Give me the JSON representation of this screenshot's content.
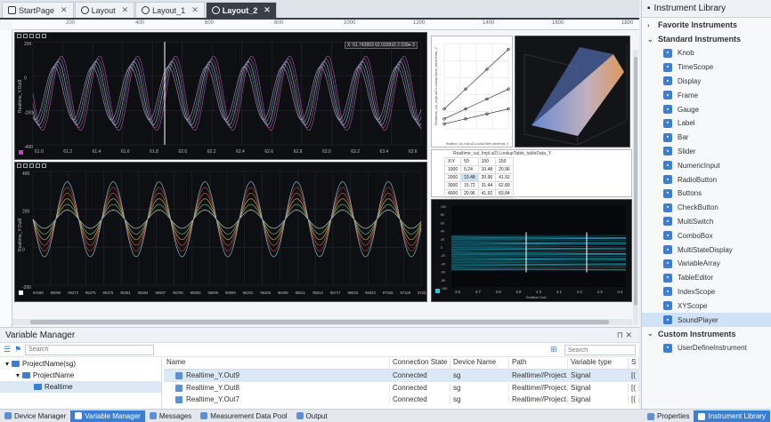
{
  "tabs": [
    {
      "label": "StartPage",
      "active": false
    },
    {
      "label": "Layout",
      "active": false
    },
    {
      "label": "Layout_1",
      "active": false
    },
    {
      "label": "Layout_2",
      "active": true
    }
  ],
  "ruler": {
    "top": [
      "200",
      "400",
      "600",
      "800",
      "1000",
      "1200",
      "1400",
      "1600",
      "1800"
    ]
  },
  "scope1": {
    "readout": "X: 61.742893   62.032893   2.039e-3",
    "y_title": "Realtime_Y.Out9",
    "y_ticks": [
      "200",
      "0",
      "-200",
      "-400"
    ],
    "x_ticks": [
      "61.0",
      "61.2",
      "61.4",
      "61.6",
      "61.8",
      "62.0",
      "62.2",
      "62.4",
      "62.6",
      "62.8",
      "63.0",
      "63.2",
      "63.4",
      "63.6"
    ]
  },
  "scope2": {
    "y_title": "Realtime_Y.Out8",
    "y_ticks": [
      "400",
      "200",
      "0",
      "-200"
    ],
    "x_ticks": [
      "94466",
      "95069",
      "95372",
      "95275",
      "95378",
      "95481",
      "95584",
      "95687",
      "95790",
      "95893",
      "96096",
      "96099",
      "96202",
      "96305",
      "96408",
      "96511",
      "96614",
      "96717",
      "96820",
      "96923",
      "97026",
      "97129",
      "97232"
    ]
  },
  "xy_chart": {
    "y_title": "Realtime_cal_Impl.uiD.LookupTable_tableData_Y",
    "x_title": "Realtime_cal_Impl.uiD.LookupTable_tableData_X"
  },
  "table_editor": {
    "title": "Realtime_cal_Impl.uiD.LookupTable_tableData_Y",
    "header": [
      "X\\Y",
      "50",
      "100",
      "150"
    ],
    "rows": [
      [
        "1000",
        "5.24",
        "10.48",
        "20.96"
      ],
      [
        "2000",
        "10.48",
        "20.96",
        "41.92"
      ],
      [
        "3000",
        "15.72",
        "31.44",
        "62.89"
      ],
      [
        "4000",
        "20.96",
        "41.92",
        "83.84"
      ]
    ]
  },
  "heatmap": {
    "y_ticks": [
      "100",
      "80",
      "60",
      "40",
      "20",
      "0",
      "-20",
      "-40",
      "-60",
      "-80",
      "-100"
    ],
    "x_ticks": [
      "3.6",
      "3.7",
      "3.8",
      "3.9",
      "4.0",
      "4.1",
      "4.2",
      "4.3",
      "4.4"
    ],
    "x_title": "Realtime.Out1"
  },
  "library": {
    "title": "Instrument Library",
    "favorite": "Favorite Instruments",
    "standard": "Standard Instruments",
    "custom": "Custom Instruments",
    "items": [
      "Knob",
      "TimeScope",
      "Display",
      "Frame",
      "Gauge",
      "Label",
      "Bar",
      "Slider",
      "NumericInput",
      "RadioButton",
      "Buttons",
      "CheckButton",
      "MultiSwitch",
      "ComboBox",
      "MultiStateDisplay",
      "VariableArray",
      "TableEditor",
      "IndexScope",
      "XYScope",
      "SoundPlayer"
    ],
    "custom_items": [
      "UserDefineInstrument"
    ]
  },
  "varman": {
    "title": "Variable Manager",
    "search_placeholder": "Search",
    "tree": [
      "ProjectName(sg)",
      "ProjectName",
      "Realtime"
    ],
    "columns": [
      "Name",
      "Connection State",
      "Device Name",
      "Path",
      "Variable type",
      "S"
    ],
    "rows": [
      {
        "name": "Realtime_Y.Out9",
        "state": "Connected",
        "device": "sg",
        "path": "Realtime//Project...",
        "type": "Signal",
        "s": "[("
      },
      {
        "name": "Realtime_Y.Out8",
        "state": "Connected",
        "device": "sg",
        "path": "Realtime//Project...",
        "type": "Signal",
        "s": "[("
      },
      {
        "name": "Realtime_Y.Out7",
        "state": "Connected",
        "device": "sg",
        "path": "Realtime//Project...",
        "type": "Signal",
        "s": "[("
      }
    ]
  },
  "statusbar": {
    "left": [
      "Device Manager",
      "Variable Manager",
      "Messages",
      "Measurement Data Pool",
      "Output"
    ],
    "right": [
      "Properties",
      "Instrument Library"
    ]
  },
  "colors": {
    "accent": "#3c7fd2",
    "dark": "#3a3f47",
    "heat": "#21c7e6"
  }
}
